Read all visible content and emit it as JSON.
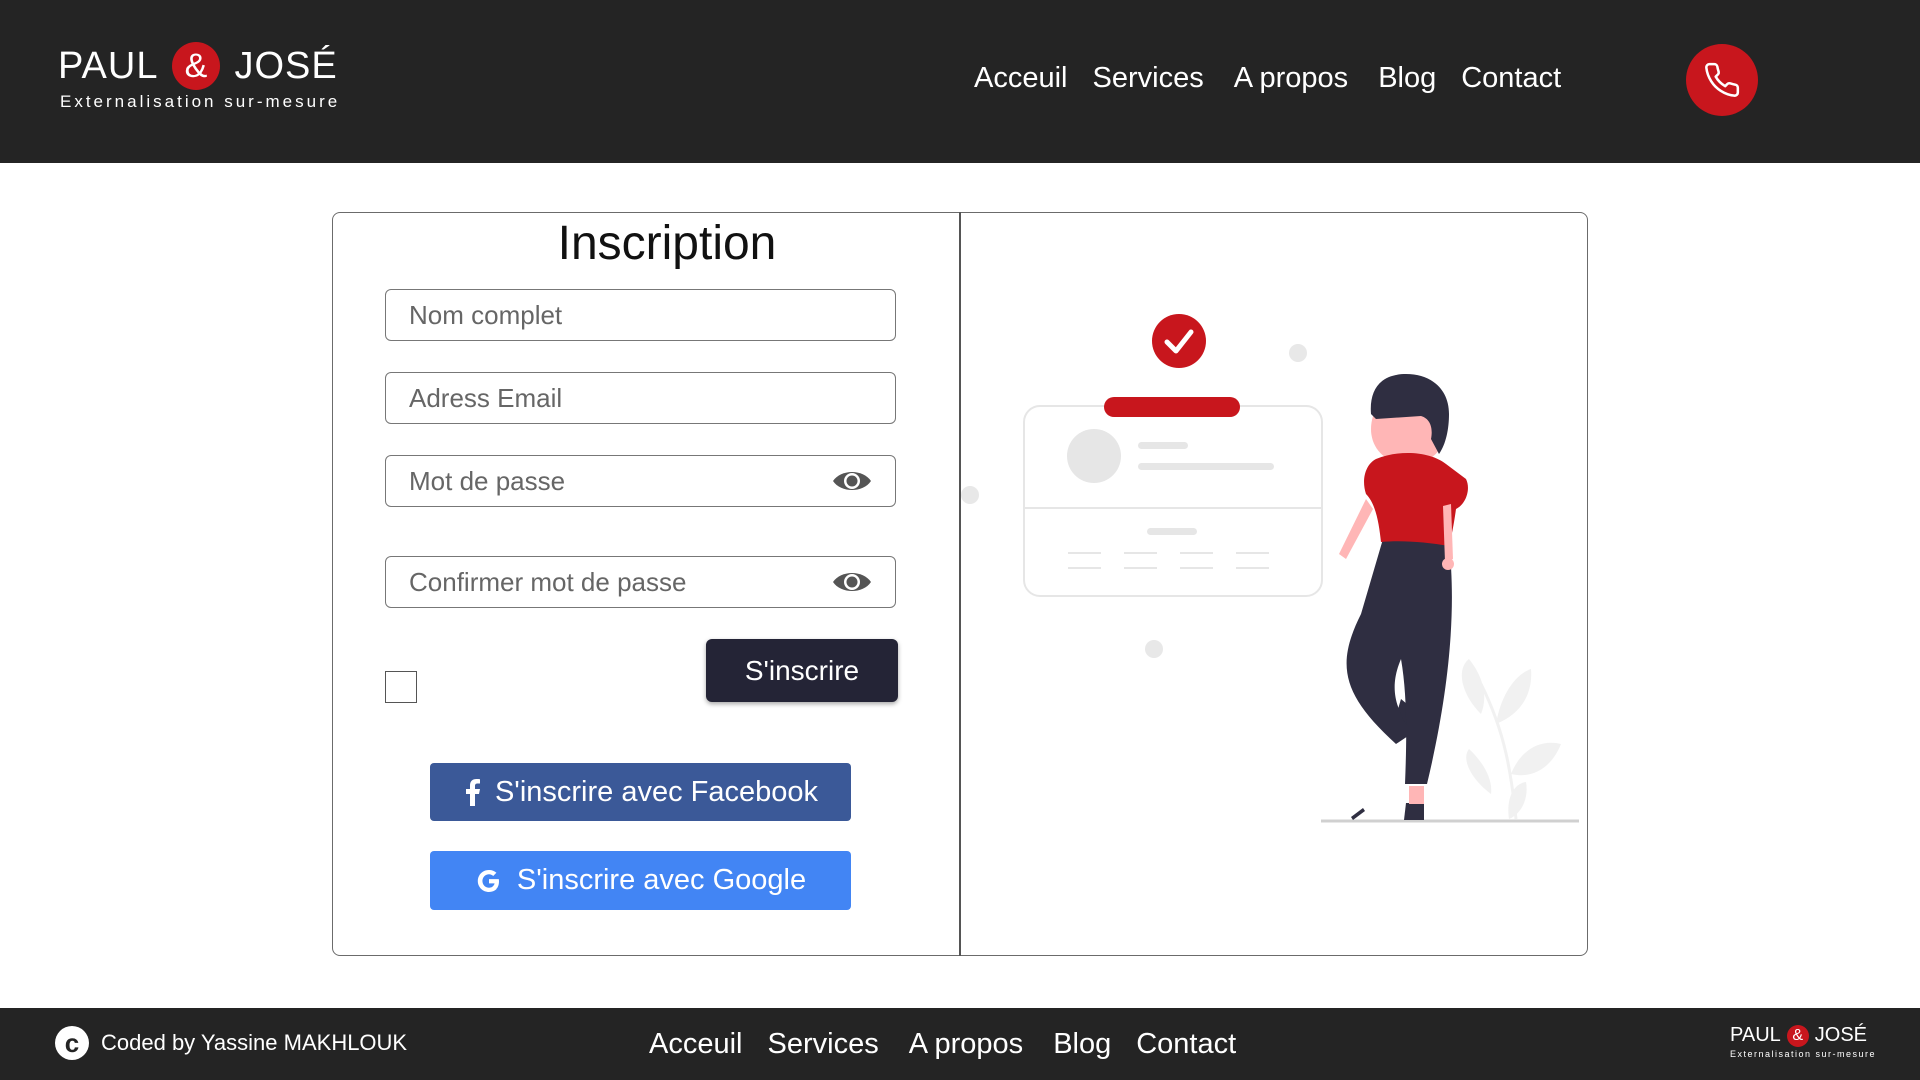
{
  "header": {
    "logo": {
      "left": "PAUL",
      "amp": "&",
      "right": "JOSÉ",
      "tagline": "Externalisation sur-mesure"
    },
    "nav": [
      "Acceuil",
      "Services",
      "A propos",
      "Blog",
      "Contact"
    ],
    "phone_icon": "phone-icon"
  },
  "form": {
    "title": "Inscription",
    "fields": {
      "fullname_placeholder": "Nom complet",
      "email_placeholder": "Adress Email",
      "password_placeholder": "Mot de passe",
      "confirm_placeholder": "Confirmer mot de passe"
    },
    "submit_label": "S'inscrire",
    "facebook_label": "S'inscrire avec Facebook",
    "google_label": "S'inscrire avec Google"
  },
  "colors": {
    "header_bg": "#242424",
    "accent_red": "#c8161d",
    "submit_bg": "#242436",
    "facebook_blue": "#3b5998",
    "google_blue": "#4285f4"
  },
  "footer": {
    "credit": "Coded by Yassine MAKHLOUK",
    "nav": [
      "Acceuil",
      "Services",
      "A propos",
      "Blog",
      "Contact"
    ],
    "logo": {
      "left": "PAUL",
      "amp": "&",
      "right": "JOSÉ",
      "tagline": "Externalisation sur-mesure"
    }
  }
}
